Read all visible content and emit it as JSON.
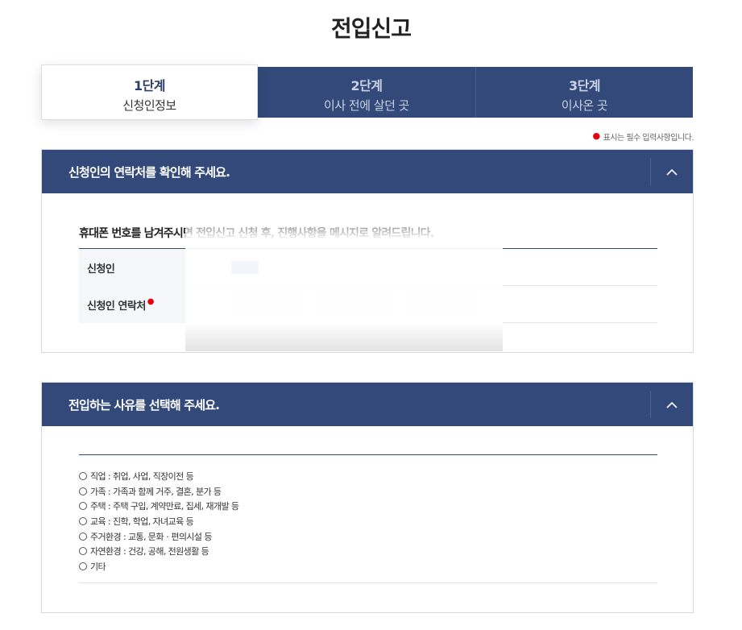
{
  "page": {
    "title": "전입신고"
  },
  "steps": [
    {
      "num": "1단계",
      "label": "신청인정보",
      "active": true
    },
    {
      "num": "2단계",
      "label": "이사 전에 살던 곳",
      "active": false
    },
    {
      "num": "3단계",
      "label": "이사온 곳",
      "active": false
    }
  ],
  "required_note": "표시는 필수 입력사항입니다.",
  "contact_section": {
    "title": "신청인의 연락처를 확인해 주세요.",
    "toggle_icon": "chevron-up-icon",
    "intro": "휴대폰 번호를 남겨주시면 전입신고 신청 후, 진행사항을 메시지로 알려드립니다.",
    "rows": [
      {
        "label": "신청인"
      },
      {
        "label": "신청인 연락처",
        "required": true
      }
    ]
  },
  "reason_section": {
    "title": "전입하는 사유를 선택해 주세요.",
    "toggle_icon": "chevron-up-icon",
    "options": [
      "직업 : 취업, 사업, 직장이전 등",
      "가족 : 가족과 함께 거주, 결혼, 분가 등",
      "주택 : 주택 구입, 계약만료, 집세, 재개발 등",
      "교육 : 진학, 학업, 자녀교육 등",
      "주거환경 : 교통, 문화ㆍ편의시설 등",
      "자연환경 : 건강, 공해, 전원생활 등",
      "기타"
    ]
  },
  "colors": {
    "primary": "#32497a",
    "required": "#e60012"
  }
}
